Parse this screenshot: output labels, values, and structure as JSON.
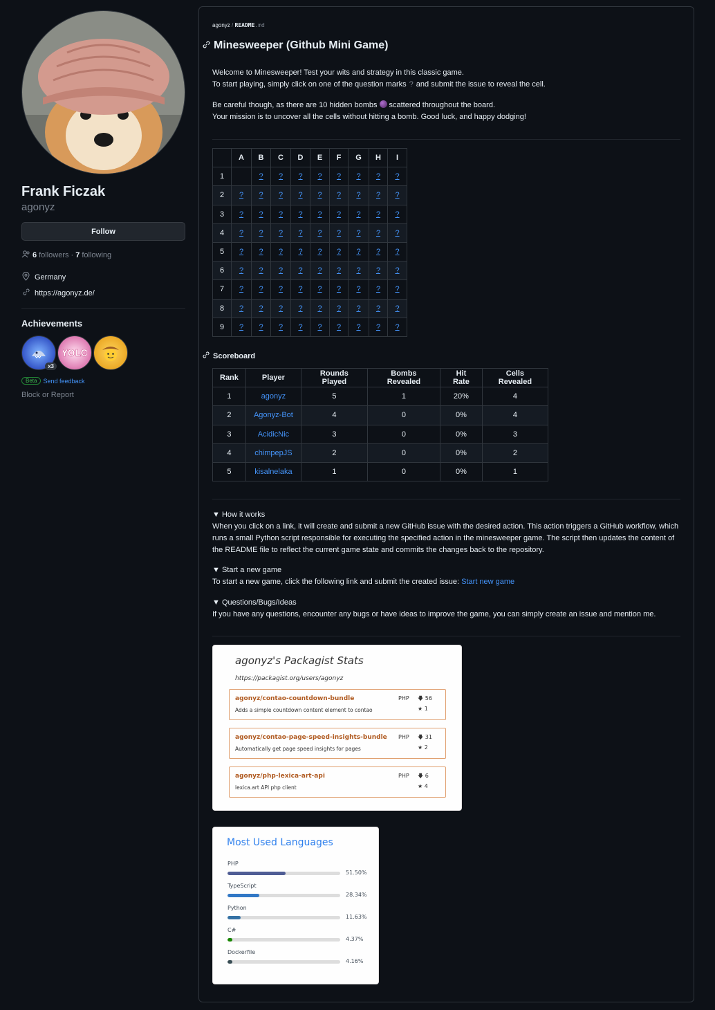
{
  "profile": {
    "fullname": "Frank Ficzak",
    "login": "agonyz",
    "follow_label": "Follow",
    "followers_count": "6",
    "followers_label": "followers",
    "separator": "·",
    "following_count": "7",
    "following_label": "following",
    "location": "Germany",
    "website": "https://agonyz.de/",
    "achievements_title": "Achievements",
    "badge_multiplier": "x3",
    "beta_label": "Beta",
    "send_feedback": "Send feedback",
    "block_report": "Block or Report"
  },
  "readme": {
    "breadcrumb_user": "agonyz",
    "breadcrumb_sep": "/",
    "breadcrumb_file": "README",
    "breadcrumb_ext": ".md",
    "title": "Minesweeper (Github Mini Game)",
    "intro_line1": "Welcome to Minesweeper! Test your wits and strategy in this classic game.",
    "intro_line2_a": "To start playing, simply click on one of the question marks",
    "intro_line2_q": "?",
    "intro_line2_b": "and submit the issue to reveal the cell.",
    "intro_line3_a": "Be careful though, as there are 10 hidden bombs",
    "intro_line3_b": "scattered throughout the board.",
    "intro_line4": "Your mission is to uncover all the cells without hitting a bomb. Good luck, and happy dodging!",
    "cell_symbol": "?"
  },
  "board": {
    "columns": [
      "A",
      "B",
      "C",
      "D",
      "E",
      "F",
      "G",
      "H",
      "I"
    ],
    "rows": [
      "1",
      "2",
      "3",
      "4",
      "5",
      "6",
      "7",
      "8",
      "9"
    ],
    "revealed_empty": [
      "1-A"
    ]
  },
  "scoreboard": {
    "title": "Scoreboard",
    "headers": [
      "Rank",
      "Player",
      "Rounds Played",
      "Bombs Revealed",
      "Hit Rate",
      "Cells Revealed"
    ],
    "rows": [
      [
        "1",
        "agonyz",
        "5",
        "1",
        "20%",
        "4"
      ],
      [
        "2",
        "Agonyz-Bot",
        "4",
        "0",
        "0%",
        "4"
      ],
      [
        "3",
        "AcidicNic",
        "3",
        "0",
        "0%",
        "3"
      ],
      [
        "4",
        "chimpepJS",
        "2",
        "0",
        "0%",
        "2"
      ],
      [
        "5",
        "kisalnelaka",
        "1",
        "0",
        "0%",
        "1"
      ]
    ]
  },
  "details": {
    "how_title": "▼ How it works",
    "how_text": "When you click on a link, it will create and submit a new GitHub issue with the desired action. This action triggers a GitHub workflow, which runs a small Python script responsible for executing the specified action in the minesweeper game. The script then updates the content of the README file to reflect the current game state and commits the changes back to the repository.",
    "new_title": "▼ Start a new game",
    "new_text": "To start a new game, click the following link and submit the created issue:",
    "new_link": "Start new game",
    "q_title": "▼ Questions/Bugs/Ideas",
    "q_text": "If you have any questions, encounter any bugs or have ideas to improve the game, you can simply create an issue and mention me."
  },
  "packagist": {
    "title": "agonyz's Packagist Stats",
    "url": "https://packagist.org/users/agonyz",
    "packages": [
      {
        "name": "agonyz/contao-countdown-bundle",
        "desc": "Adds a simple countdown content element to contao",
        "lang": "PHP",
        "downloads": "56",
        "stars": "1"
      },
      {
        "name": "agonyz/contao-page-speed-insights-bundle",
        "desc": "Automatically get page speed insights for pages",
        "lang": "PHP",
        "downloads": "31",
        "stars": "2"
      },
      {
        "name": "agonyz/php-lexica-art-api",
        "desc": "lexica.art API php client",
        "lang": "PHP",
        "downloads": "6",
        "stars": "4"
      }
    ]
  },
  "languages": {
    "title": "Most Used Languages",
    "items": [
      {
        "name": "PHP",
        "pct": "51.50%",
        "value": 51.5,
        "color": "#4F5D95"
      },
      {
        "name": "TypeScript",
        "pct": "28.34%",
        "value": 28.34,
        "color": "#3178c6"
      },
      {
        "name": "Python",
        "pct": "11.63%",
        "value": 11.63,
        "color": "#3572A5"
      },
      {
        "name": "C#",
        "pct": "4.37%",
        "value": 4.37,
        "color": "#178600"
      },
      {
        "name": "Dockerfile",
        "pct": "4.16%",
        "value": 4.16,
        "color": "#384d54"
      }
    ]
  }
}
